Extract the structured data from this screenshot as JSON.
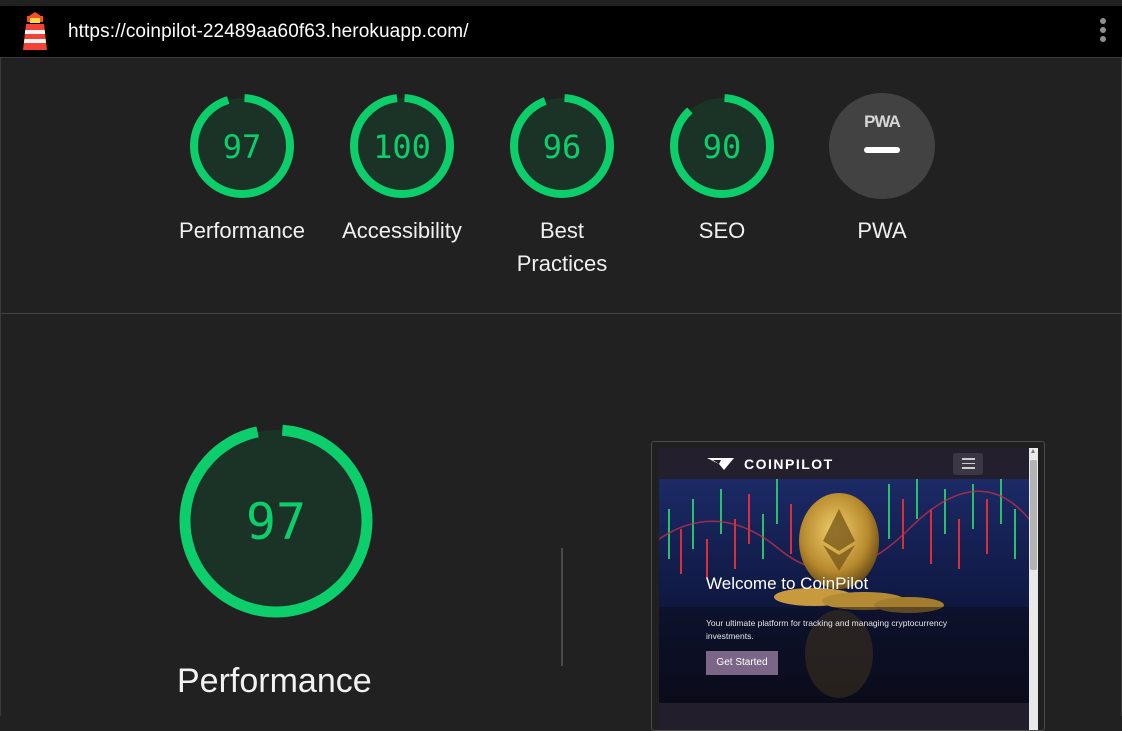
{
  "url_bar": {
    "url": "https://coinpilot-22489aa60f63.herokuapp.com/"
  },
  "colors": {
    "pass": "#0cce6b",
    "pass_fill": "#1b3326",
    "pwa_bg": "#424242",
    "background": "#212121"
  },
  "categories": [
    {
      "label": "Performance",
      "score": "97",
      "fraction": 0.97
    },
    {
      "label": "Accessibility",
      "score": "100",
      "fraction": 1.0
    },
    {
      "label": "Best Practices",
      "score": "96",
      "fraction": 0.96
    },
    {
      "label": "SEO",
      "score": "90",
      "fraction": 0.9
    }
  ],
  "pwa": {
    "label": "PWA",
    "badge_text": "PWA"
  },
  "performance_section": {
    "score": "97",
    "fraction": 0.97,
    "title": "Performance"
  },
  "screenshot": {
    "brand": "COINPILOT",
    "hero_title": "Welcome to CoinPilot",
    "hero_subtitle": "Your ultimate platform for tracking and managing cryptocurrency investments.",
    "cta_label": "Get Started"
  }
}
